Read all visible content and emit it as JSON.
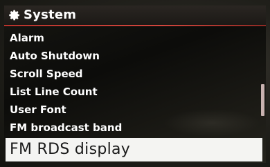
{
  "header": {
    "title": "System",
    "icon": "gear-icon"
  },
  "menu": {
    "items": [
      {
        "label": "Alarm"
      },
      {
        "label": "Auto Shutdown"
      },
      {
        "label": "Scroll Speed"
      },
      {
        "label": "List Line Count"
      },
      {
        "label": "User Font"
      },
      {
        "label": "FM broadcast band"
      },
      {
        "label": "FM RDS display",
        "selected": true
      }
    ]
  },
  "scrollbar": {
    "position_fraction": 0.71
  },
  "colors": {
    "accent_rule": "#c63c34",
    "selected_background": "#f4f4f2",
    "text": "#ffffff"
  }
}
